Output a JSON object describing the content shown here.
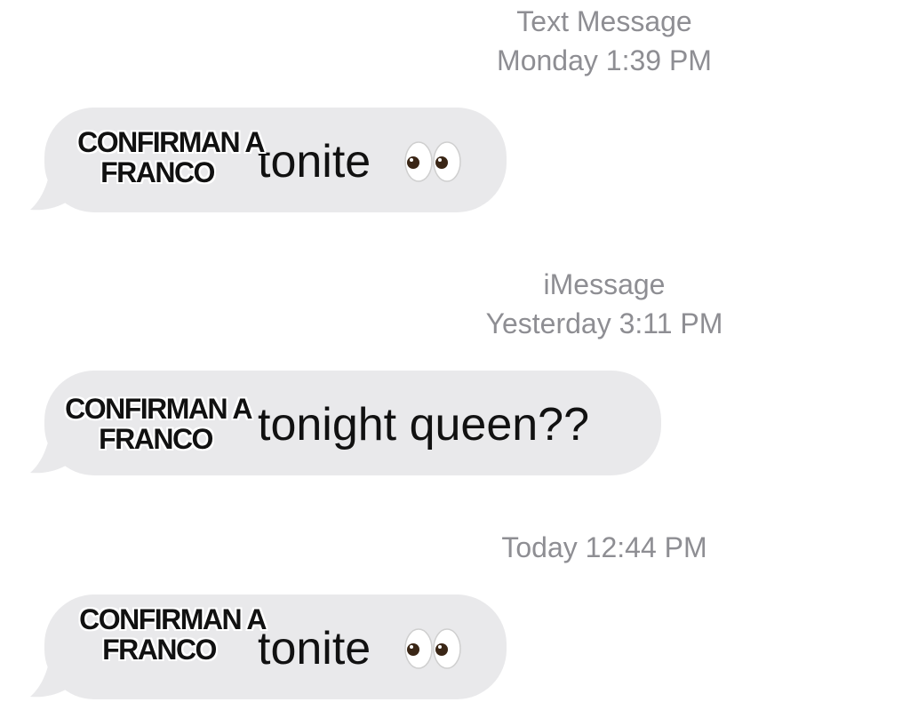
{
  "conversation": [
    {
      "service": "Text Message",
      "time": "Monday 1:39 PM",
      "message": {
        "text": "tonite",
        "emoji": "👀",
        "overlay_line1": "CONFIRMAN A",
        "overlay_line2": "FRANCO"
      }
    },
    {
      "service": "iMessage",
      "time": "Yesterday 3:11 PM",
      "message": {
        "text": "tonight queen??",
        "overlay_line1": "CONFIRMAN A",
        "overlay_line2": "FRANCO"
      }
    },
    {
      "time": "Today 12:44 PM",
      "message": {
        "text": "tonite",
        "emoji": "👀",
        "overlay_line1": "CONFIRMAN A",
        "overlay_line2": "FRANCO"
      }
    }
  ],
  "colors": {
    "bubble": "#e9e9eb",
    "timestamp": "#8e8e93",
    "text": "#111111"
  },
  "icons": {
    "eyes": "eyes-emoji-icon",
    "tail": "bubble-tail-icon"
  }
}
